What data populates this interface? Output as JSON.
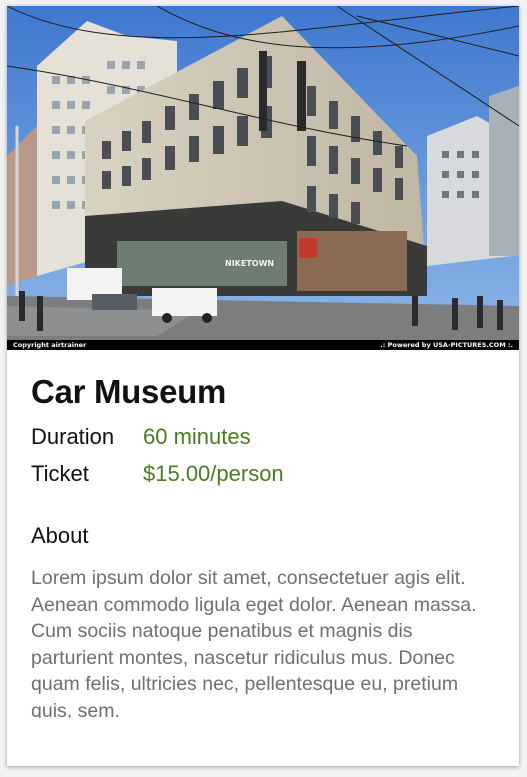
{
  "hero": {
    "image_alt": "Street corner with the Niketown building",
    "storefront_sign": "NIKETOWN",
    "credit_left": "Copyright airtrainer",
    "credit_right": ".: Powered by USA-PICTURES.COM :."
  },
  "place": {
    "title": "Car Museum",
    "duration_label": "Duration",
    "duration_value": "60 minutes",
    "ticket_label": "Ticket",
    "ticket_value": "$15.00/person"
  },
  "about": {
    "heading": "About",
    "text": "Lorem ipsum dolor sit amet, consectetuer agis elit. Aenean commodo ligula eget dolor. Aenean massa. Cum sociis natoque penatibus et magnis dis parturient montes, nascetur ridiculus mus. Donec quam felis, ultricies nec, pellentesque eu, pretium quis, sem."
  },
  "colors": {
    "accent_green": "#4a7d1e",
    "body_text": "#707070",
    "sky": "#5d92d6"
  }
}
